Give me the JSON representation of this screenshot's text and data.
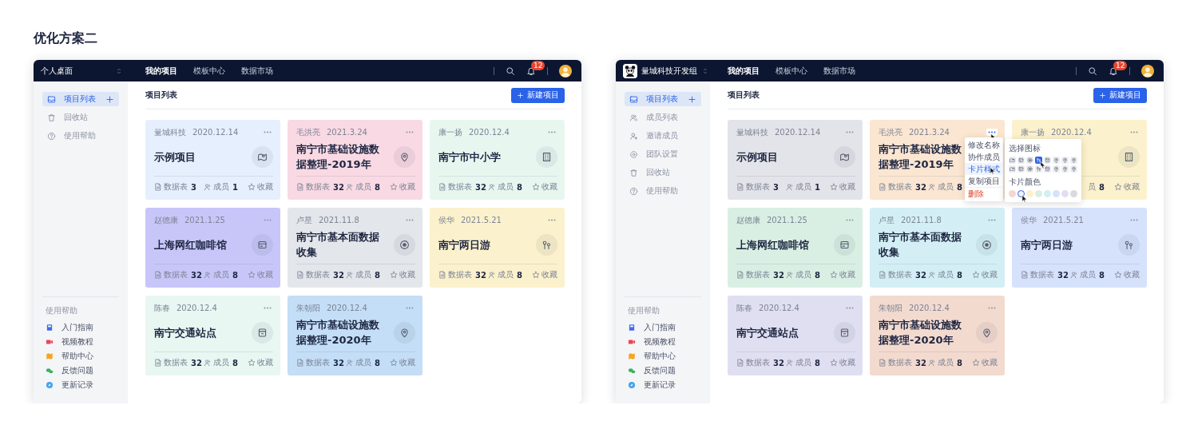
{
  "heading": "优化方案二",
  "screens": [
    {
      "team": {
        "name": "个人桌面",
        "logo": false
      },
      "nav": [
        {
          "label": "我的项目",
          "selected": true
        },
        {
          "label": "模板中心",
          "selected": false
        },
        {
          "label": "数据市场",
          "selected": false
        }
      ],
      "notifications": "12",
      "sidebar": [
        {
          "label": "项目列表",
          "kind": "inbox",
          "selected": true,
          "add": true
        },
        {
          "label": "回收站",
          "kind": "trash",
          "selected": false,
          "add": false
        },
        {
          "label": "使用帮助",
          "kind": "help",
          "selected": false,
          "add": false
        }
      ],
      "help": {
        "title": "使用帮助",
        "links": [
          {
            "label": "入门指南",
            "kind": "book",
            "color": "#3d6cf0"
          },
          {
            "label": "视频教程",
            "kind": "video",
            "color": "#e8465a"
          },
          {
            "label": "帮助中心",
            "kind": "foldmap",
            "color": "#f5a524"
          },
          {
            "label": "反馈问题",
            "kind": "chat",
            "color": "#3bb061"
          },
          {
            "label": "更新记录",
            "kind": "compass",
            "color": "#4aa3f0"
          }
        ]
      },
      "page_title": "项目列表",
      "new_button": "新建项目",
      "cards": [
        {
          "owner": "量城科技",
          "date": "2020.12.14",
          "title": "示例项目",
          "kind": "map",
          "color": "#e6effd",
          "tables_label": "数据表",
          "tables": "3",
          "members_label": "成员",
          "members": "1",
          "favorite": "收藏",
          "menu_open": false
        },
        {
          "owner": "毛洪亮",
          "date": "2021.3.24",
          "title": "南宁市基础设施数据整理-2019年",
          "kind": "pin",
          "color": "#f9d9e3",
          "tables_label": "数据表",
          "tables": "32",
          "members_label": "成员",
          "members": "8",
          "favorite": "收藏",
          "menu_open": false
        },
        {
          "owner": "康一扬",
          "date": "2020.12.4",
          "title": "南宁市中小学",
          "kind": "building",
          "color": "#e7f7f0",
          "tables_label": "数据表",
          "tables": "32",
          "members_label": "成员",
          "members": "8",
          "favorite": "收藏",
          "menu_open": false
        },
        {
          "owner": "赵德康",
          "date": "2021.1.25",
          "title": "上海网红咖啡馆",
          "kind": "store",
          "color": "#c8c6f9",
          "tables_label": "数据表",
          "tables": "32",
          "members_label": "成员",
          "members": "8",
          "favorite": "收藏",
          "menu_open": false
        },
        {
          "owner": "卢星",
          "date": "2021.11.8",
          "title": "南宁市基本面数据收集",
          "kind": "target",
          "color": "#e3e6ea",
          "tables_label": "数据表",
          "tables": "32",
          "members_label": "成员",
          "members": "8",
          "favorite": "收藏",
          "menu_open": false
        },
        {
          "owner": "侯华",
          "date": "2021.5.21",
          "title": "南宁两日游",
          "kind": "signpost",
          "color": "#fbf1cc",
          "tables_label": "数据表",
          "tables": "32",
          "members_label": "成员",
          "members": "8",
          "favorite": "收藏",
          "menu_open": false
        },
        {
          "owner": "陈春",
          "date": "2020.12.4",
          "title": "南宁交通站点",
          "kind": "box",
          "color": "#e8f7f1",
          "tables_label": "数据表",
          "tables": "32",
          "members_label": "成员",
          "members": "8",
          "favorite": "收藏",
          "menu_open": false
        },
        {
          "owner": "朱朝阳",
          "date": "2020.12.4",
          "title": "南宁市基础设施数据整理-2020年",
          "kind": "pin",
          "color": "#c3def6",
          "tables_label": "数据表",
          "tables": "32",
          "members_label": "成员",
          "members": "8",
          "favorite": "收藏",
          "menu_open": false
        }
      ]
    },
    {
      "team": {
        "name": "量城科技开发组",
        "logo": true
      },
      "nav": [
        {
          "label": "我的项目",
          "selected": true
        },
        {
          "label": "模板中心",
          "selected": false
        },
        {
          "label": "数据市场",
          "selected": false
        }
      ],
      "notifications": "12",
      "sidebar": [
        {
          "label": "项目列表",
          "kind": "inbox",
          "selected": true,
          "add": true
        },
        {
          "label": "成员列表",
          "kind": "users",
          "selected": false,
          "add": false
        },
        {
          "label": "邀请成员",
          "kind": "useradd",
          "selected": false,
          "add": false
        },
        {
          "label": "团队设置",
          "kind": "gear",
          "selected": false,
          "add": false
        },
        {
          "label": "回收站",
          "kind": "trash",
          "selected": false,
          "add": false
        },
        {
          "label": "使用帮助",
          "kind": "help",
          "selected": false,
          "add": false
        }
      ],
      "help": {
        "title": "使用帮助",
        "links": [
          {
            "label": "入门指南",
            "kind": "book",
            "color": "#3d6cf0"
          },
          {
            "label": "视频教程",
            "kind": "video",
            "color": "#e8465a"
          },
          {
            "label": "帮助中心",
            "kind": "foldmap",
            "color": "#f5a524"
          },
          {
            "label": "反馈问题",
            "kind": "chat",
            "color": "#3bb061"
          },
          {
            "label": "更新记录",
            "kind": "compass",
            "color": "#4aa3f0"
          }
        ]
      },
      "page_title": "项目列表",
      "new_button": "新建项目",
      "cards": [
        {
          "owner": "量城科技",
          "date": "2020.12.14",
          "title": "示例项目",
          "kind": "map",
          "color": "#e3e4e9",
          "tables_label": "数据表",
          "tables": "3",
          "members_label": "成员",
          "members": "1",
          "favorite": "收藏",
          "menu_open": false
        },
        {
          "owner": "毛洪亮",
          "date": "2021.3.24",
          "title": "南宁市基础设施数据整理-2019年",
          "color": "#fbe6d2",
          "tables_label": "数据表",
          "tables": "32",
          "members_label": "成员",
          "members": "8",
          "menu_open": true
        },
        {
          "owner": "康一扬",
          "date": "2020.12.4",
          "kind": "building",
          "color": "#fbf1cc",
          "members_label": "员",
          "members": "8",
          "favorite": "收藏",
          "menu_open": false
        },
        {
          "owner": "赵德康",
          "date": "2021.1.25",
          "title": "上海网红咖啡馆",
          "kind": "store",
          "color": "#d9efe3",
          "tables_label": "数据表",
          "tables": "32",
          "members_label": "成员",
          "members": "8",
          "favorite": "收藏",
          "menu_open": false
        },
        {
          "owner": "卢星",
          "date": "2021.11.8",
          "title": "南宁市基本面数据收集",
          "kind": "target",
          "color": "#d3eff5",
          "tables_label": "数据表",
          "tables": "32",
          "members_label": "成员",
          "members": "8",
          "favorite": "收藏",
          "menu_open": false
        },
        {
          "owner": "侯华",
          "date": "2021.5.21",
          "title": "南宁两日游",
          "kind": "signpost",
          "color": "#d6e2fb",
          "tables_label": "数据表",
          "tables": "32",
          "members_label": "成员",
          "members": "8",
          "favorite": "收藏",
          "menu_open": false
        },
        {
          "owner": "陈春",
          "date": "2020.12.4",
          "title": "南宁交通站点",
          "kind": "box",
          "color": "#e0dff2",
          "tables_label": "数据表",
          "tables": "32",
          "members_label": "成员",
          "members": "8",
          "favorite": "收藏",
          "menu_open": false
        },
        {
          "owner": "朱朝阳",
          "date": "2020.12.4",
          "title": "南宁市基础设施数据整理-2020年",
          "kind": "pin",
          "color": "#f3dacf",
          "tables_label": "数据表",
          "tables": "32",
          "members_label": "成员",
          "members": "8",
          "favorite": "收藏",
          "menu_open": false
        }
      ],
      "card_menu": {
        "items": [
          {
            "label": "修改名称",
            "kind": "normal",
            "selected": false
          },
          {
            "label": "协作成员",
            "kind": "normal",
            "selected": false
          },
          {
            "label": "卡片样式",
            "kind": "normal",
            "selected": true
          },
          {
            "label": "复制项目",
            "kind": "normal",
            "selected": false
          },
          {
            "label": "删除",
            "kind": "danger",
            "selected": false
          }
        ],
        "icon_title": "选择图标",
        "icons": [
          {
            "kind": "map",
            "selected": false
          },
          {
            "kind": "store",
            "selected": false
          },
          {
            "kind": "target",
            "selected": false
          },
          {
            "kind": "signpost",
            "selected": true
          },
          {
            "kind": "box",
            "selected": false
          },
          {
            "kind": "pin",
            "selected": false
          },
          {
            "kind": "pin",
            "selected": false
          },
          {
            "kind": "pin",
            "selected": false
          },
          {
            "kind": "map",
            "selected": false
          },
          {
            "kind": "store",
            "selected": false
          },
          {
            "kind": "target",
            "selected": false
          },
          {
            "kind": "signpost",
            "selected": false
          },
          {
            "kind": "box",
            "selected": false
          },
          {
            "kind": "pin",
            "selected": false
          },
          {
            "kind": "pin",
            "selected": false
          },
          {
            "kind": "pin",
            "selected": false
          }
        ],
        "color_title": "卡片颜色",
        "colors": [
          {
            "color": "#f6d6d2",
            "selected": false
          },
          {
            "color": "#eef3fd",
            "selected": true
          },
          {
            "color": "#fbf1cc",
            "selected": false
          },
          {
            "color": "#d9efe3",
            "selected": false
          },
          {
            "color": "#d3eff5",
            "selected": false
          },
          {
            "color": "#d6e2fb",
            "selected": false
          },
          {
            "color": "#e0dff2",
            "selected": false
          },
          {
            "color": "#d8dade",
            "selected": false
          }
        ]
      }
    }
  ]
}
